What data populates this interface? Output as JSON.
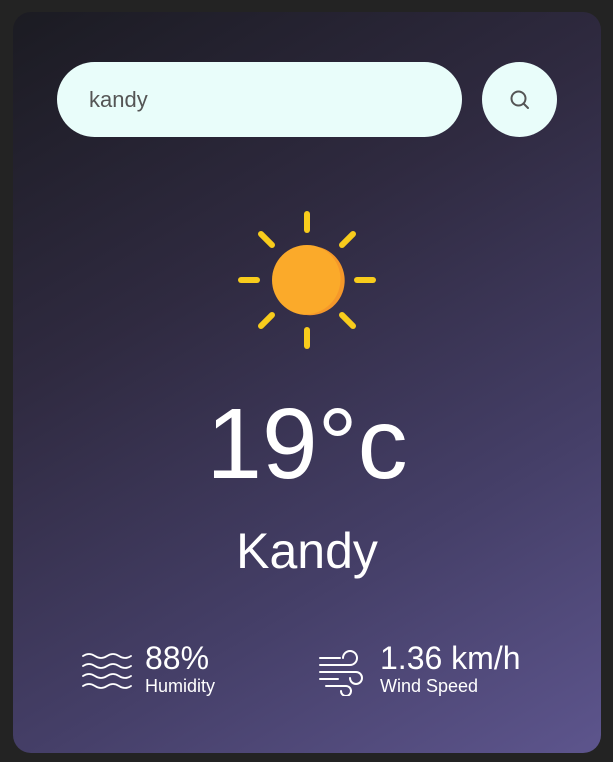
{
  "search": {
    "value": "kandy",
    "button_icon": "search-icon"
  },
  "weather": {
    "icon": "sun-icon",
    "temperature": "19°c",
    "city": "Kandy"
  },
  "details": {
    "humidity": {
      "value": "88%",
      "label": "Humidity",
      "icon": "humidity-waves-icon"
    },
    "wind": {
      "value": "1.36 km/h",
      "label": "Wind Speed",
      "icon": "wind-icon"
    }
  },
  "colors": {
    "input_bg": "#e9fdfa",
    "sun_body": "#fbaa2a",
    "sun_rays": "#f8cc1c",
    "text": "#ffffff"
  }
}
